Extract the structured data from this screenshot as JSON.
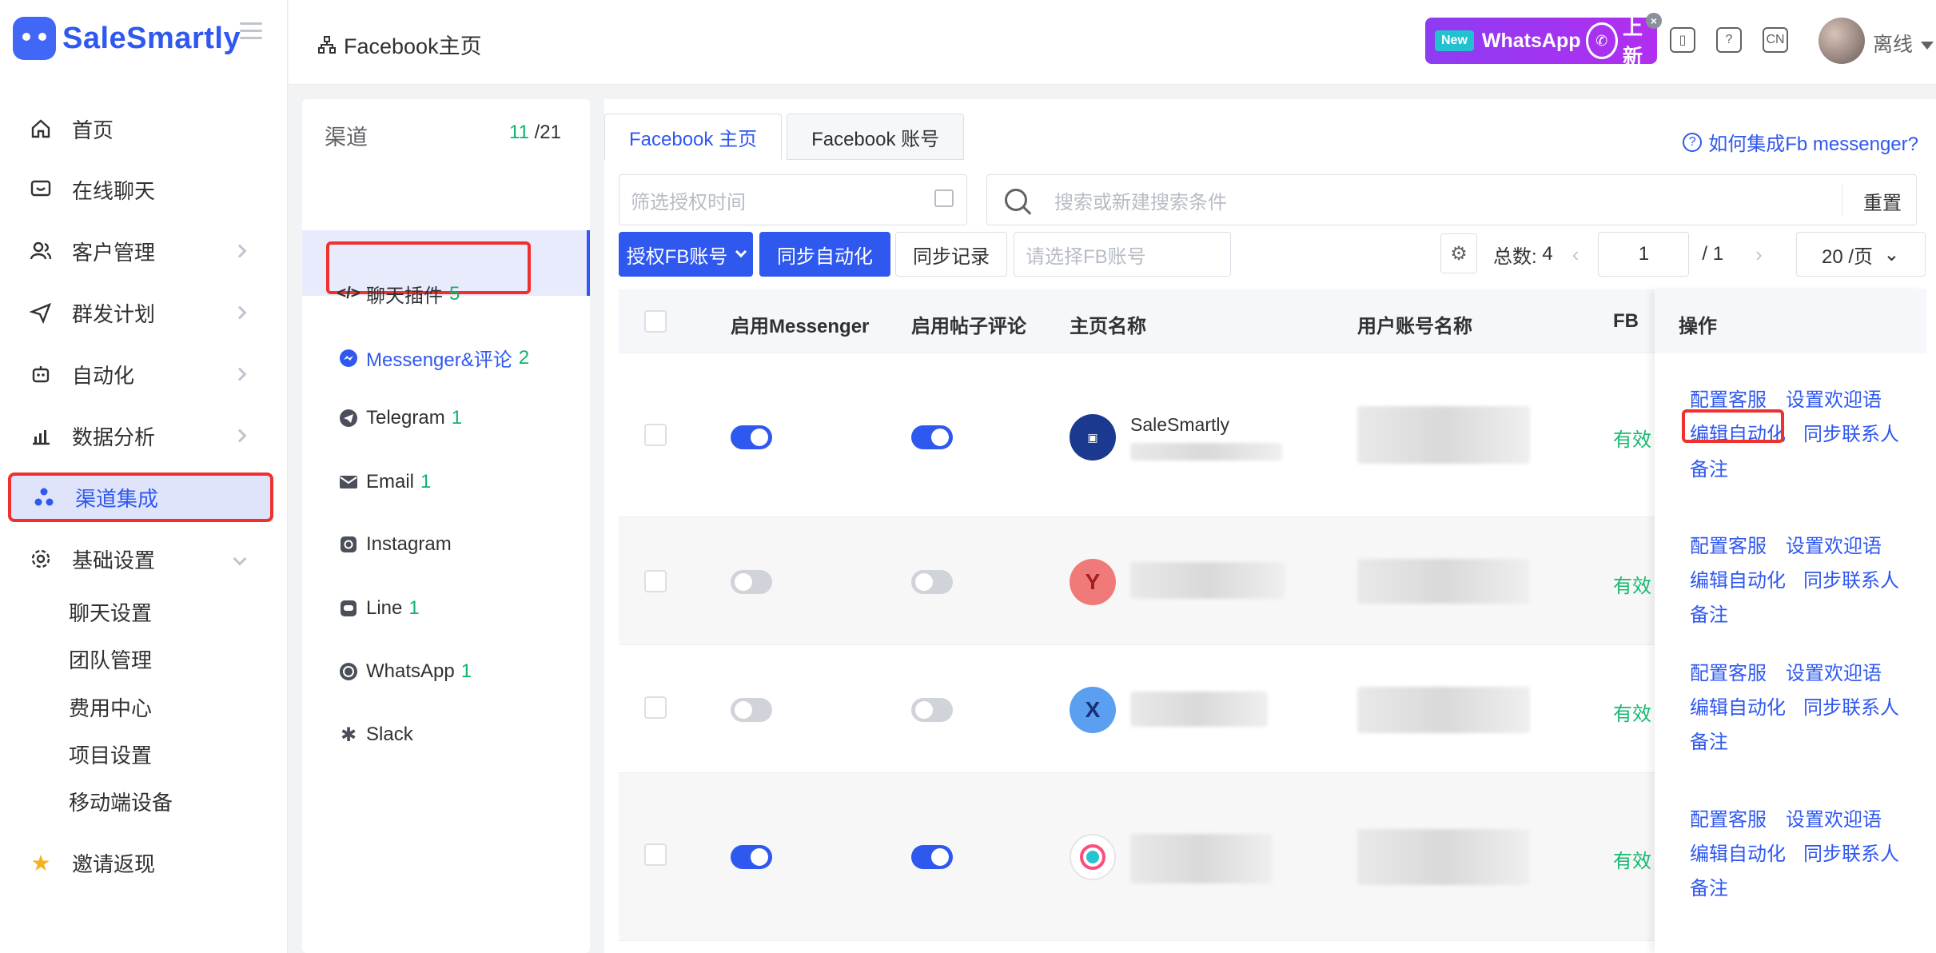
{
  "app": {
    "brand": "SaleSmartly"
  },
  "nav": {
    "items": [
      {
        "label": "首页",
        "icon": "home-icon"
      },
      {
        "label": "在线聊天",
        "icon": "chat-icon"
      },
      {
        "label": "客户管理",
        "icon": "users-icon"
      },
      {
        "label": "群发计划",
        "icon": "send-icon"
      },
      {
        "label": "自动化",
        "icon": "robot-icon"
      },
      {
        "label": "数据分析",
        "icon": "chart-icon"
      },
      {
        "label": "渠道集成",
        "icon": "integration-icon"
      },
      {
        "label": "基础设置",
        "icon": "gear-icon"
      }
    ],
    "subitems": [
      "聊天设置",
      "团队管理",
      "费用中心",
      "项目设置",
      "移动端设备"
    ],
    "invite": "邀请返现"
  },
  "header": {
    "breadcrumb": "Facebook主页",
    "promo": {
      "new": "New",
      "text": "WhatsApp",
      "suffix": "上新",
      "close": "×"
    },
    "user_status": "离线"
  },
  "channels": {
    "title": "渠道",
    "count_active": "11",
    "count_total": "/21",
    "items": [
      {
        "label": "聊天插件",
        "count": "5"
      },
      {
        "label": "Messenger&评论",
        "count": "2"
      },
      {
        "label": "Telegram",
        "count": "1"
      },
      {
        "label": "Email",
        "count": "1"
      },
      {
        "label": "Instagram",
        "count": ""
      },
      {
        "label": "Line",
        "count": "1"
      },
      {
        "label": "WhatsApp",
        "count": "1"
      },
      {
        "label": "Slack",
        "count": ""
      }
    ]
  },
  "main": {
    "tabs": [
      "Facebook 主页",
      "Facebook 账号"
    ],
    "help": "如何集成Fb messenger?",
    "date_placeholder": "筛选授权时间",
    "search_placeholder": "搜索或新建搜索条件",
    "reset": "重置",
    "buttons": {
      "auth": "授权FB账号",
      "sync_auto": "同步自动化",
      "sync_log": "同步记录"
    },
    "fb_placeholder": "请选择FB账号",
    "pager": {
      "total_label": "总数:",
      "total": "4",
      "page": "1",
      "pages": "/  1",
      "size": "20 /页"
    },
    "columns": [
      "启用Messenger",
      "启用帖子评论",
      "主页名称",
      "用户账号名称",
      "FB",
      "操作"
    ],
    "rows": [
      {
        "name": "SaleSmartly",
        "avatar_text": "",
        "status": "有效",
        "ops": [
          "配置客服",
          "设置欢迎语",
          "编辑自动化",
          "同步联系人",
          "备注"
        ]
      },
      {
        "name": "",
        "avatar_text": "Y",
        "status": "有效",
        "ops": [
          "配置客服",
          "设置欢迎语",
          "编辑自动化",
          "同步联系人",
          "备注"
        ]
      },
      {
        "name": "",
        "avatar_text": "X",
        "status": "有效",
        "ops": [
          "配置客服",
          "设置欢迎语",
          "编辑自动化",
          "同步联系人",
          "备注"
        ]
      },
      {
        "name": "",
        "avatar_text": "",
        "status": "有效",
        "ops": [
          "配置客服",
          "设置欢迎语",
          "编辑自动化",
          "同步联系人",
          "备注"
        ]
      }
    ]
  }
}
